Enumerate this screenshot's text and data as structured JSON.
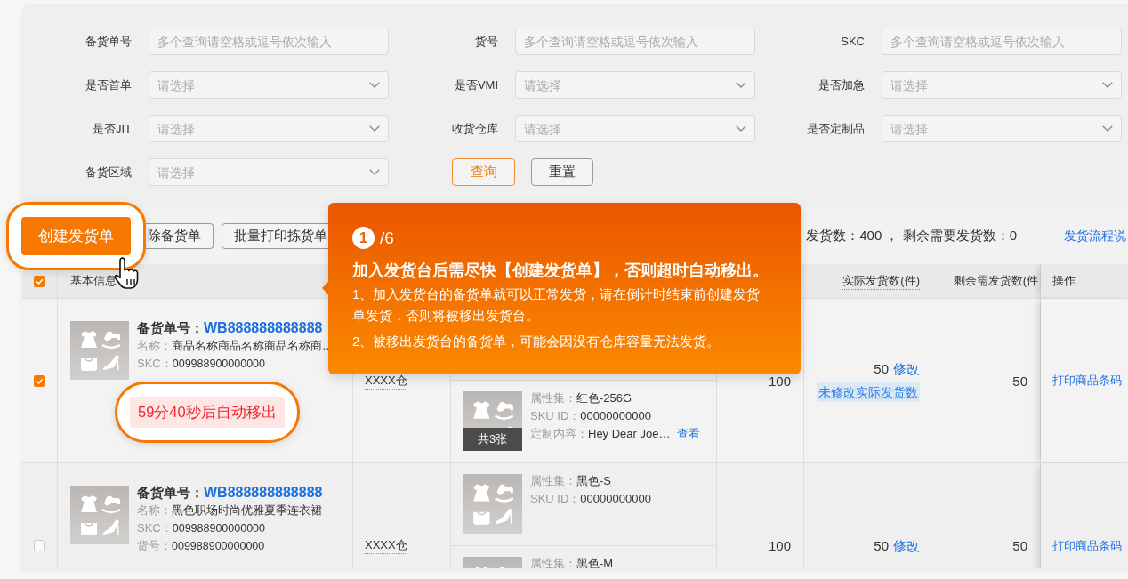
{
  "filters": {
    "fields": [
      {
        "label": "备货单号",
        "kind": "text",
        "placeholder": "多个查询请空格或逗号依次输入"
      },
      {
        "label": "货号",
        "kind": "text",
        "placeholder": "多个查询请空格或逗号依次输入"
      },
      {
        "label": "SKC",
        "kind": "text",
        "placeholder": "多个查询请空格或逗号依次输入"
      },
      {
        "label": "是否首单",
        "kind": "select",
        "placeholder": "请选择"
      },
      {
        "label": "是否VMI",
        "kind": "select",
        "placeholder": "请选择"
      },
      {
        "label": "是否加急",
        "kind": "select",
        "placeholder": "请选择"
      },
      {
        "label": "是否JIT",
        "kind": "select",
        "placeholder": "请选择"
      },
      {
        "label": "收货仓库",
        "kind": "select",
        "placeholder": "请选择"
      },
      {
        "label": "是否定制品",
        "kind": "select",
        "placeholder": "请选择"
      },
      {
        "label": "备货区域",
        "kind": "select",
        "placeholder": "请选择"
      }
    ],
    "buttons": [
      {
        "label": "查询",
        "kind": "primary"
      },
      {
        "label": "重置",
        "kind": "default"
      }
    ]
  },
  "toolbar": {
    "buttons": [
      {
        "label": "创建发货单",
        "kind": "primary",
        "spotlight": true
      },
      {
        "label": "除备货单",
        "kind": "default",
        "spotlight": false
      },
      {
        "label": "批量打印拣货单",
        "kind": "default",
        "spotlight": false
      }
    ],
    "summary": "发货数：400 ， 剩余需要发货数：0",
    "help_link": "发货流程说"
  },
  "table": {
    "header": {
      "select_all": true,
      "basic_info": "基本信息",
      "shipped": "实际发货数(件)",
      "remaining": "剩余需发货数(件",
      "actions": "操作"
    },
    "rows": [
      {
        "selected": true,
        "order_label": "备货单号：",
        "order_no": "WB888888888888",
        "details": [
          {
            "label": "名称：",
            "value": "商品名称商品名称商品名称商…"
          },
          {
            "label": "SKC：",
            "value": "009988900000000"
          }
        ],
        "timer": {
          "text": "59分40秒后自动移出",
          "spotlight": true
        },
        "warehouse": "XXXX仓",
        "skus": [
          {
            "image_count": "共3张",
            "attributes": [
              {
                "label": "属性集：",
                "value": "红色-256G"
              },
              {
                "label": "SKU ID：",
                "value": "00000000000"
              },
              {
                "label": "定制内容：",
                "value": "Hey Dear Joe…",
                "link": "查看"
              }
            ]
          }
        ],
        "quantity": "100",
        "shipped": {
          "value": "50",
          "edit": "修改",
          "tag": "未修改实际发货数"
        },
        "remaining": "50",
        "action": "打印商品条码"
      },
      {
        "selected": false,
        "order_label": "备货单号：",
        "order_no": "WB888888888888",
        "details": [
          {
            "label": "名称：",
            "value": "黑色职场时尚优雅夏季连衣裙"
          },
          {
            "label": "SKC：",
            "value": "009988900000000"
          },
          {
            "label": "货号：",
            "value": "009988900000000"
          }
        ],
        "warehouse": "XXXX仓",
        "skus": [
          {
            "attributes": [
              {
                "label": "属性集：",
                "value": "黑色-S"
              },
              {
                "label": "SKU ID：",
                "value": "00000000000"
              }
            ]
          },
          {
            "attributes": [
              {
                "label": "属性集：",
                "value": "黑色-M"
              }
            ]
          }
        ],
        "quantity": "100",
        "shipped": {
          "value": "50",
          "edit": "修改"
        },
        "remaining": "50",
        "action": "打印商品条码"
      }
    ]
  },
  "guide": {
    "step": "1",
    "total": "/6",
    "title": "加入发货台后需尽快【创建发货单】，否则超时自动移出。",
    "paragraphs": [
      "1、加入发货台的备货单就可以正常发货，请在倒计时结束前创建发货单发货，否则将被移出发货台。",
      "2、被移出发货台的备货单，可能会因没有仓库容量无法发货。"
    ]
  }
}
